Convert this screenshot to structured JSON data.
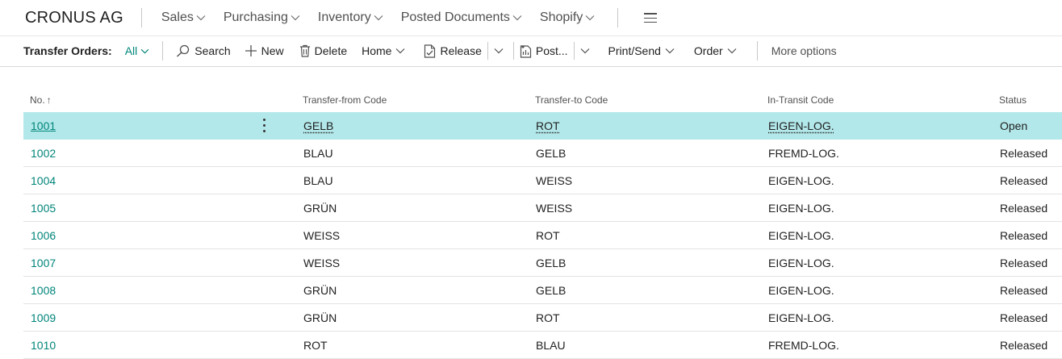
{
  "brand": "CRONUS AG",
  "nav": [
    {
      "label": "Sales",
      "has_dropdown": true
    },
    {
      "label": "Purchasing",
      "has_dropdown": true
    },
    {
      "label": "Inventory",
      "has_dropdown": true
    },
    {
      "label": "Posted Documents",
      "has_dropdown": true
    },
    {
      "label": "Shopify",
      "has_dropdown": true
    }
  ],
  "actionbar": {
    "page_title": "Transfer Orders:",
    "filter": "All",
    "search": "Search",
    "new": "New",
    "delete": "Delete",
    "home": "Home",
    "release": "Release",
    "post": "Post...",
    "print_send": "Print/Send",
    "order": "Order",
    "more_options": "More options"
  },
  "table": {
    "columns": [
      "No.",
      "Transfer-from Code",
      "Transfer-to Code",
      "In-Transit Code",
      "Status"
    ],
    "sort_indicator": "↑",
    "rows": [
      {
        "no": "1001",
        "from": "GELB",
        "to": "ROT",
        "transit": "EIGEN-LOG.",
        "status": "Open",
        "selected": true
      },
      {
        "no": "1002",
        "from": "BLAU",
        "to": "GELB",
        "transit": "FREMD-LOG.",
        "status": "Released"
      },
      {
        "no": "1004",
        "from": "BLAU",
        "to": "WEISS",
        "transit": "EIGEN-LOG.",
        "status": "Released"
      },
      {
        "no": "1005",
        "from": "GRÜN",
        "to": "WEISS",
        "transit": "EIGEN-LOG.",
        "status": "Released"
      },
      {
        "no": "1006",
        "from": "WEISS",
        "to": "ROT",
        "transit": "EIGEN-LOG.",
        "status": "Released"
      },
      {
        "no": "1007",
        "from": "WEISS",
        "to": "GELB",
        "transit": "EIGEN-LOG.",
        "status": "Released"
      },
      {
        "no": "1008",
        "from": "GRÜN",
        "to": "GELB",
        "transit": "EIGEN-LOG.",
        "status": "Released"
      },
      {
        "no": "1009",
        "from": "GRÜN",
        "to": "ROT",
        "transit": "EIGEN-LOG.",
        "status": "Released"
      },
      {
        "no": "1010",
        "from": "ROT",
        "to": "BLAU",
        "transit": "FREMD-LOG.",
        "status": "Released"
      }
    ]
  },
  "colors": {
    "accent": "#00857a",
    "selected_row": "#b3e8ea",
    "text": "#212121",
    "muted": "#505050"
  },
  "icons": {
    "nav_dropdown": "chevron-down-icon",
    "menu": "hamburger-icon",
    "search": "search-icon",
    "new": "plus-icon",
    "delete": "trash-icon",
    "release": "document-check-icon",
    "post": "document-post-icon",
    "row_actions": "kebab-icon"
  }
}
